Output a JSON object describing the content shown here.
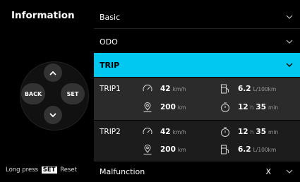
{
  "left": {
    "title": "Information",
    "back_label": "BACK",
    "set_label": "SET",
    "long_press_prefix": "Long press",
    "long_press_chip": "SET",
    "long_press_suffix": "Reset"
  },
  "menu": {
    "basic": "Basic",
    "odo": "ODO",
    "trip": "TRIP",
    "malfunction": "Malfunction",
    "malfunction_value": "X"
  },
  "trip1": {
    "name": "TRIP1",
    "speed": "42",
    "speed_unit": "km/h",
    "fuel": "6.2",
    "fuel_unit": "L/100km",
    "distance": "200",
    "distance_unit": "km",
    "time_h": "12",
    "time_h_unit": "h",
    "time_m": "35",
    "time_m_unit": "min"
  },
  "trip2": {
    "name": "TRIP2",
    "speed": "42",
    "speed_unit": "km/h",
    "time_h": "12",
    "time_h_unit": "h",
    "time_m": "35",
    "time_m_unit": "min",
    "distance": "200",
    "distance_unit": "km",
    "fuel": "6.2",
    "fuel_unit": "L/100km"
  },
  "colors": {
    "accent": "#00c8f0",
    "panel": "#2b2b2b"
  },
  "icons": [
    "speedometer-icon",
    "fuel-pump-icon",
    "location-pin-icon",
    "stopwatch-icon",
    "chevron-down-icon",
    "chevron-up-icon"
  ]
}
